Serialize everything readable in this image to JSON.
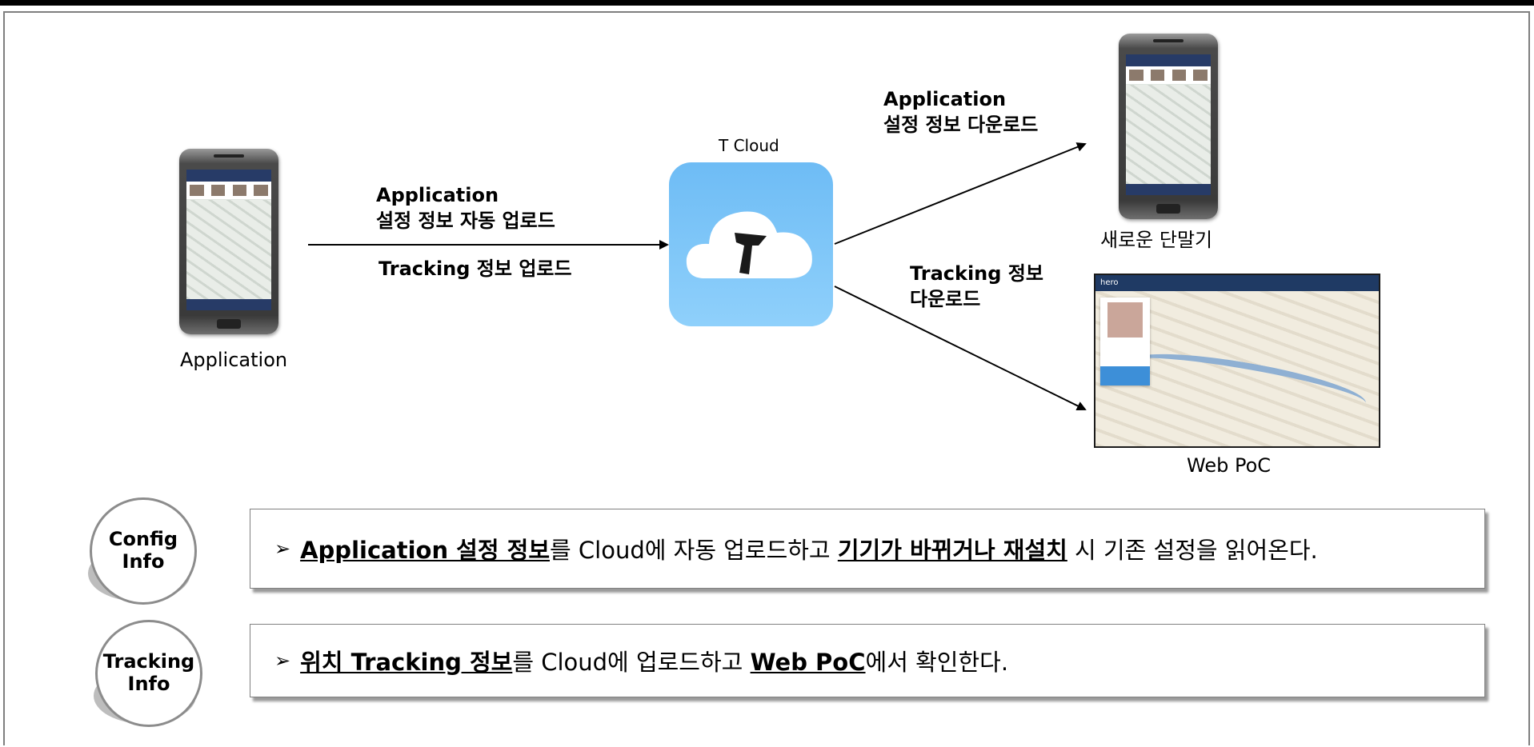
{
  "nodes": {
    "source_label": "Application",
    "cloud_label": "T Cloud",
    "new_device_label": "새로운 단말기",
    "web_label": "Web PoC",
    "web_header_brand": "hero"
  },
  "edges": {
    "upload_config": [
      "Application",
      "설정 정보 자동 업로드"
    ],
    "upload_tracking": "Tracking 정보 업로드",
    "download_config": [
      "Application",
      "설정 정보 다운로드"
    ],
    "download_tracking": [
      "Tracking 정보",
      "다운로드"
    ]
  },
  "info": [
    {
      "badge": [
        "Config",
        "Info"
      ],
      "seg1": "Application 설정 정보",
      "seg2": "를 Cloud에 자동 업로드하고 ",
      "seg3": "기기가 바뀌거나 재설치",
      "seg4": " 시 기존 설정을 읽어온다."
    },
    {
      "badge": [
        "Tracking",
        "Info"
      ],
      "seg1": "위치 Tracking 정보",
      "seg2": "를 Cloud에 업로드하고 ",
      "seg3": "Web PoC",
      "seg4": "에서 확인한다."
    }
  ],
  "bullet_symbol": "➢",
  "colors": {
    "frame": "#7f7f7f",
    "cloud": "#7cc4f8",
    "header": "#273b67"
  }
}
